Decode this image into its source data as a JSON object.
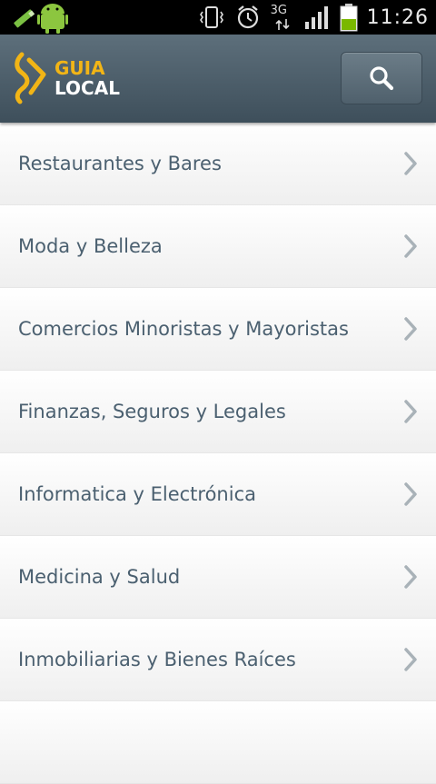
{
  "status_bar": {
    "network": "3G",
    "time": "11:26"
  },
  "app_bar": {
    "logo_line1": "GUIA",
    "logo_line2": "LOCAL"
  },
  "categories": [
    {
      "label": "Restaurantes y Bares"
    },
    {
      "label": "Moda y Belleza"
    },
    {
      "label": "Comercios Minoristas y Mayoristas"
    },
    {
      "label": "Finanzas, Seguros y Legales"
    },
    {
      "label": "Informatica y Electrónica"
    },
    {
      "label": "Medicina y Salud"
    },
    {
      "label": "Inmobiliarias y Bienes Raíces"
    },
    {
      "label": ""
    }
  ],
  "colors": {
    "app_bar": "#4a5b67",
    "logo_accent": "#f2b516",
    "item_text": "#4b6070",
    "chevron": "#a9b2b8"
  }
}
